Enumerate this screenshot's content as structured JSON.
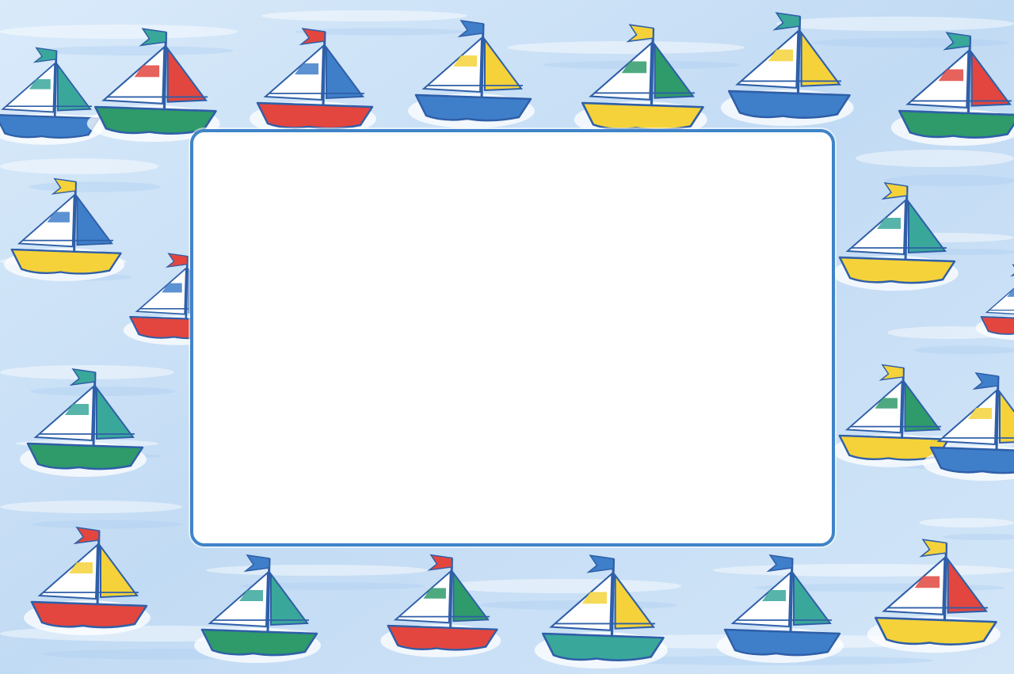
{
  "palette": {
    "sky_light": "#e6f1fb",
    "sky_mid": "#c3dcf5",
    "sky_deep": "#9fc4ee",
    "outline": "#2f5fa8",
    "frame_border": "#3f84c8",
    "frame_fill": "#ffffff",
    "red": "#e2463f",
    "yellow": "#f5d23a",
    "green": "#2f9a6a",
    "blue": "#3f7fca",
    "teal": "#3aa79b",
    "sail_white": "#ffffff"
  },
  "boats": [
    {
      "hull": "blue",
      "sail": "teal",
      "flag": "teal"
    },
    {
      "hull": "green",
      "sail": "red",
      "flag": "teal"
    },
    {
      "hull": "red",
      "sail": "blue",
      "flag": "red"
    },
    {
      "hull": "blue",
      "sail": "yellow",
      "flag": "blue"
    },
    {
      "hull": "yellow",
      "sail": "green",
      "flag": "yellow"
    },
    {
      "hull": "blue",
      "sail": "yellow",
      "flag": "teal"
    },
    {
      "hull": "green",
      "sail": "red",
      "flag": "teal"
    },
    {
      "hull": "yellow",
      "sail": "blue",
      "flag": "yellow"
    },
    {
      "hull": "red",
      "sail": "blue",
      "flag": "red"
    },
    {
      "hull": "yellow",
      "sail": "teal",
      "flag": "yellow"
    },
    {
      "hull": "red",
      "sail": "blue",
      "flag": "blue"
    },
    {
      "hull": "green",
      "sail": "teal",
      "flag": "teal"
    },
    {
      "hull": "yellow",
      "sail": "green",
      "flag": "yellow"
    },
    {
      "hull": "blue",
      "sail": "yellow",
      "flag": "blue"
    },
    {
      "hull": "red",
      "sail": "yellow",
      "flag": "red"
    },
    {
      "hull": "green",
      "sail": "teal",
      "flag": "blue"
    },
    {
      "hull": "red",
      "sail": "green",
      "flag": "red"
    },
    {
      "hull": "teal",
      "sail": "yellow",
      "flag": "blue"
    },
    {
      "hull": "blue",
      "sail": "teal",
      "flag": "blue"
    },
    {
      "hull": "yellow",
      "sail": "red",
      "flag": "yellow"
    }
  ]
}
